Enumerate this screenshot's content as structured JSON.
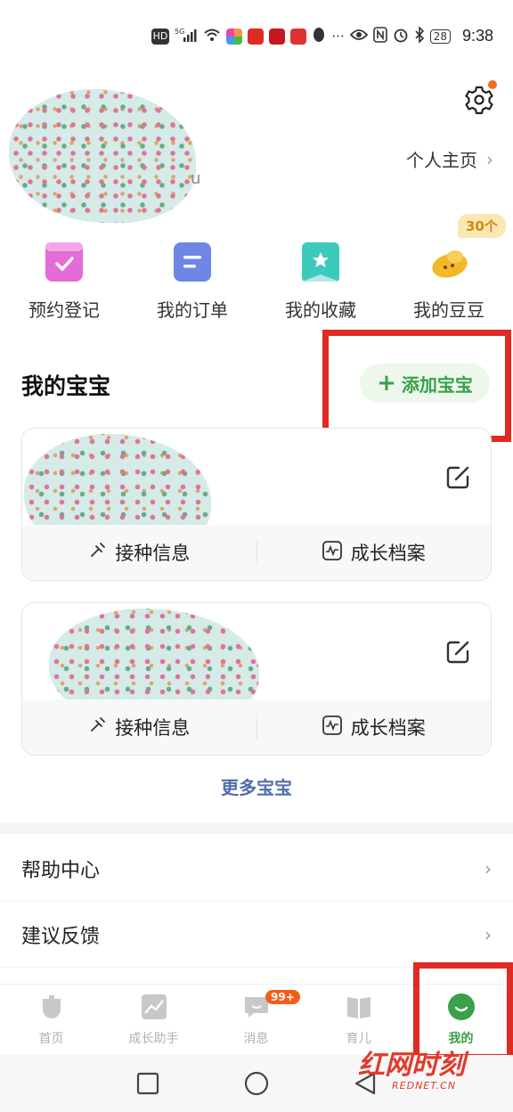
{
  "status_bar": {
    "left_icons": [
      "HD",
      "5G",
      "wifi",
      "app-icons"
    ],
    "battery": "28",
    "time": "9:38"
  },
  "header": {
    "user_suffix": "u",
    "profile_link": "个人主页",
    "has_notification_dot": true
  },
  "quick_actions": [
    {
      "label": "预约登记",
      "icon": "calendar-check-icon",
      "color": "#e36cd6"
    },
    {
      "label": "我的订单",
      "icon": "order-list-icon",
      "color": "#6f86e6"
    },
    {
      "label": "我的收藏",
      "icon": "bookmark-star-icon",
      "color": "#3ec9bd"
    },
    {
      "label": "我的豆豆",
      "icon": "bean-icon",
      "color": "#f2b827",
      "tag": "30个"
    }
  ],
  "babies_section": {
    "title": "我的宝宝",
    "add_button": "添加宝宝",
    "cards": [
      {
        "vaccine_label": "接种信息",
        "growth_label": "成长档案"
      },
      {
        "vaccine_label": "接种信息",
        "growth_label": "成长档案"
      }
    ],
    "more_label": "更多宝宝"
  },
  "menu": [
    {
      "label": "帮助中心"
    },
    {
      "label": "建议反馈"
    }
  ],
  "tabbar": [
    {
      "label": "首页",
      "icon": "home-icon",
      "active": false
    },
    {
      "label": "成长助手",
      "icon": "chart-icon",
      "active": false
    },
    {
      "label": "消息",
      "icon": "message-icon",
      "active": false,
      "badge": "99+"
    },
    {
      "label": "育儿",
      "icon": "book-icon",
      "active": false
    },
    {
      "label": "我的",
      "icon": "smile-icon",
      "active": true
    }
  ],
  "colors": {
    "accent_green": "#3aa04a",
    "highlight_red": "#e02a24",
    "link_blue": "#4f6fa8",
    "badge_orange": "#f25e18"
  },
  "watermark": {
    "text": "红网时刻",
    "sub": "REDNET.CN"
  }
}
